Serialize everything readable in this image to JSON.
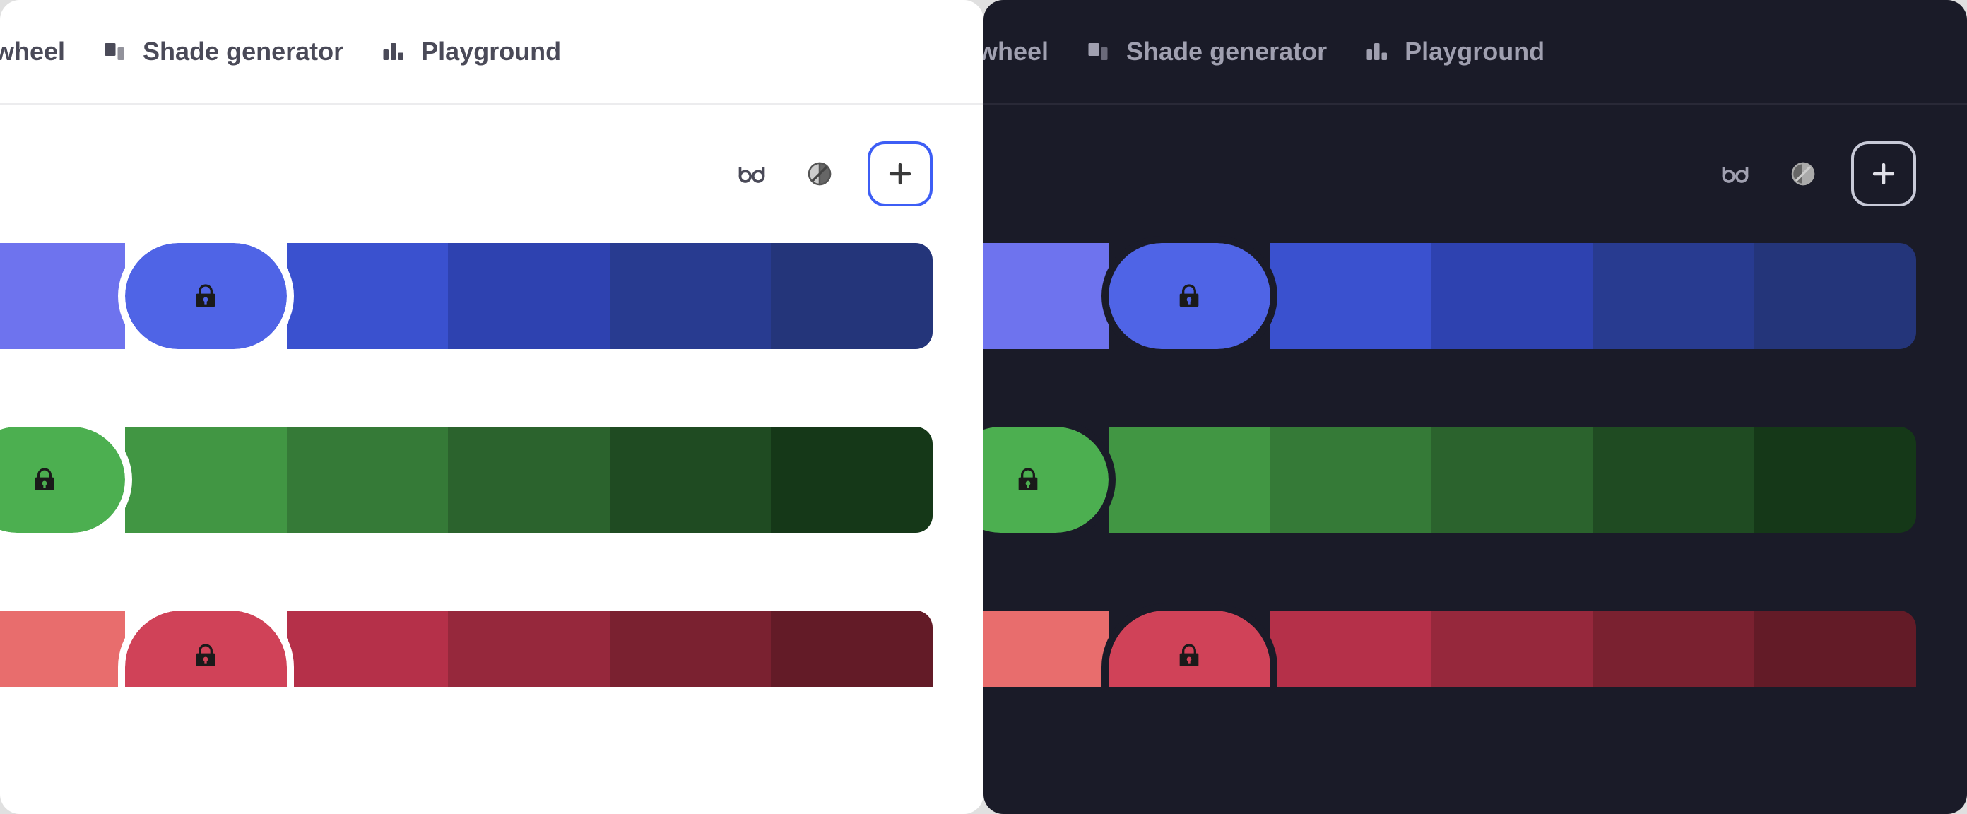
{
  "tabs": [
    {
      "label": "lor wheel",
      "full_label": "Color wheel",
      "icon": "color-wheel-icon"
    },
    {
      "label": "Shade generator",
      "icon": "shade-generator-icon"
    },
    {
      "label": "Playground",
      "icon": "playground-icon"
    }
  ],
  "toolbar": {
    "glasses_label": "glasses-icon",
    "contrast_label": "contrast-icon",
    "add_label": "plus-icon"
  },
  "palettes": [
    {
      "locked_index": 2,
      "swatches": [
        "#8e91f2",
        "#6e73ee",
        "#4f64e6",
        "#3a51cf",
        "#2e42b0",
        "#283b90",
        "#24357a"
      ]
    },
    {
      "locked_index": 1,
      "swatches": [
        "#6fcb6f",
        "#4caf50",
        "#419643",
        "#357a37",
        "#2b632d",
        "#1f4b22",
        "#153818"
      ]
    },
    {
      "locked_index": 2,
      "swatches": [
        "#f08888",
        "#e86d6d",
        "#d04258",
        "#b53049",
        "#96283c",
        "#7a2130",
        "#631b27"
      ]
    }
  ],
  "themes": {
    "light": "#ffffff",
    "dark": "#1a1b28"
  }
}
